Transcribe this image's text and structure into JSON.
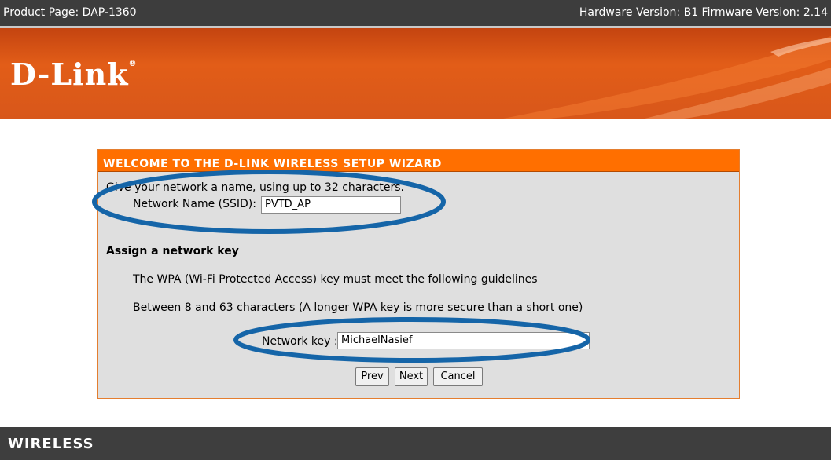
{
  "topbar": {
    "product": "Product Page: DAP-1360",
    "versions": "Hardware Version: B1  Firmware Version: 2.14"
  },
  "banner": {
    "logo": "D-Link",
    "logo_mark": "®"
  },
  "wizard": {
    "title": "WELCOME TO THE D-LINK WIRELESS SETUP WIZARD",
    "ssid_intro": "Give your network a name, using up to 32 characters.",
    "ssid_label": "Network Name (SSID):",
    "ssid_value": "PVTD_AP",
    "key_heading": "Assign a network key",
    "guideline_1": "The WPA (Wi-Fi Protected Access) key must meet the following guidelines",
    "guideline_2": "Between 8 and 63 characters (A longer WPA key is more secure than a short one)",
    "key_label": "Network key :",
    "key_value": "MichaelNasief",
    "buttons": {
      "prev": "Prev",
      "next": "Next",
      "cancel": "Cancel"
    }
  },
  "footer": {
    "label": "WIRELESS"
  },
  "colors": {
    "accent": "#ff6f00",
    "banner": "#d8571a",
    "panel": "#dfdfdf",
    "annotation": "#1565a8",
    "header": "#3d3d3d"
  }
}
